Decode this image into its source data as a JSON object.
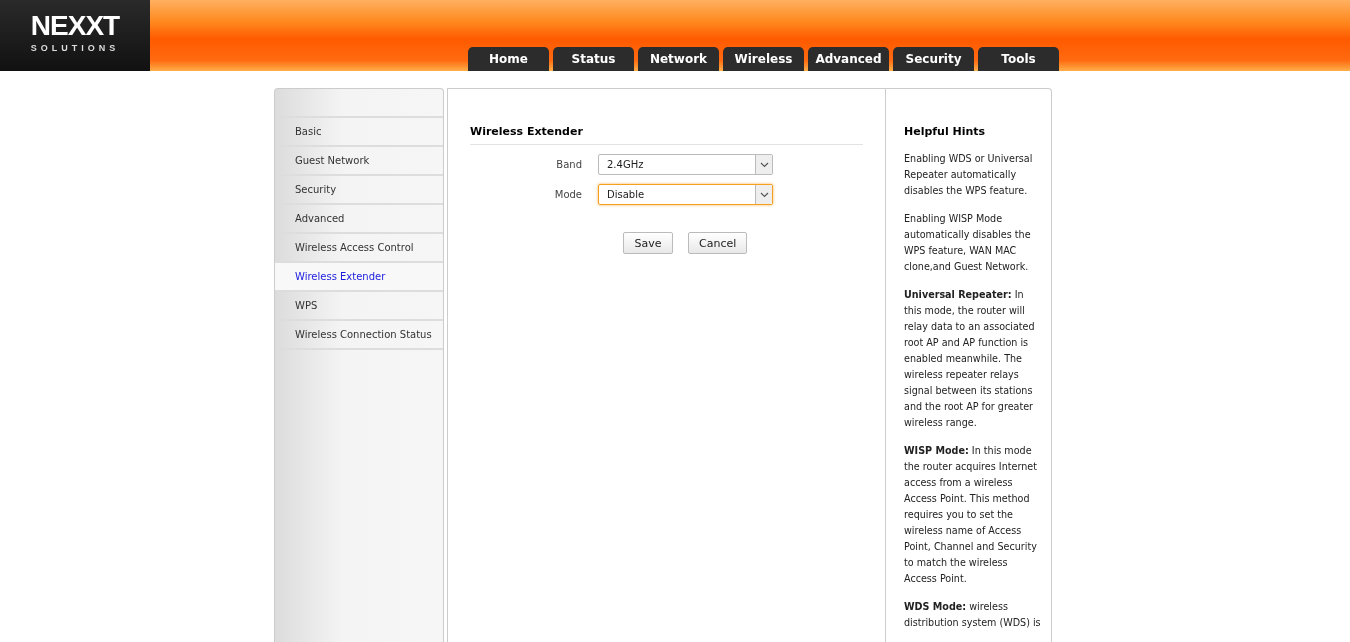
{
  "logo": {
    "brand": "NEXXT",
    "tagline": "SOLUTIONS"
  },
  "tabs": [
    {
      "label": "Home"
    },
    {
      "label": "Status"
    },
    {
      "label": "Network"
    },
    {
      "label": "Wireless"
    },
    {
      "label": "Advanced"
    },
    {
      "label": "Security"
    },
    {
      "label": "Tools"
    }
  ],
  "sidebar": {
    "items": [
      {
        "label": "Basic",
        "selected": false
      },
      {
        "label": "Guest Network",
        "selected": false
      },
      {
        "label": "Security",
        "selected": false
      },
      {
        "label": "Advanced",
        "selected": false
      },
      {
        "label": "Wireless Access Control",
        "selected": false
      },
      {
        "label": "Wireless Extender",
        "selected": true
      },
      {
        "label": "WPS",
        "selected": false
      },
      {
        "label": "Wireless Connection Status",
        "selected": false
      }
    ]
  },
  "form": {
    "title": "Wireless Extender",
    "fields": [
      {
        "label": "Band",
        "value": "2.4GHz",
        "focused": false
      },
      {
        "label": "Mode",
        "value": "Disable",
        "focused": true
      }
    ],
    "buttons": [
      "Save",
      "Cancel"
    ]
  },
  "hints": {
    "title": "Helpful Hints",
    "paragraphs": [
      "Enabling WDS or Universal Repeater automatically disables the WPS feature.",
      "Enabling WISP Mode automatically disables the WPS feature, WAN MAC clone,and Guest Network.",
      "**Universal Repeater:** In this mode, the router will relay data to an associated root AP and AP function is enabled meanwhile. The wireless repeater relays signal between its stations and the root AP for greater wireless range.",
      "**WISP Mode:** In this mode the router acquires Internet access from a wireless Access Point. This method requires you to set the wireless name of Access Point, Channel and Security to match the wireless Access Point.",
      "**WDS Mode:** wireless distribution system (WDS) is"
    ]
  }
}
